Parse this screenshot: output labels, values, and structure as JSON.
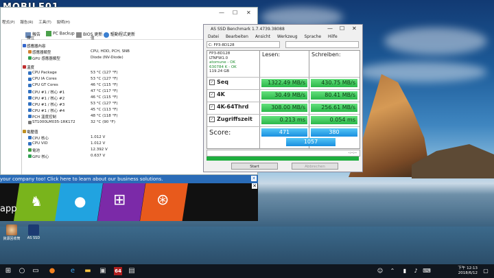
{
  "watermark": "MOBILE01",
  "hwinfo": {
    "menu": [
      "程式(P)",
      "報告(R)",
      "工具(T)",
      "說明(H)"
    ],
    "toolbar": [
      {
        "label": "報告",
        "icon": "report-icon"
      },
      {
        "label": "PC Backup",
        "icon": "backup-icon"
      },
      {
        "label": "BIOS 更新",
        "icon": "bios-icon"
      },
      {
        "label": "驅動程式更新",
        "icon": "driver-update-icon"
      }
    ],
    "columns": {
      "name": "欄位",
      "value": "值"
    },
    "rows": [
      {
        "type": "section",
        "label": "感應器內容",
        "value": "",
        "color": "#3366cc"
      },
      {
        "type": "item",
        "label": "感應器類型",
        "value": "CPU, HDD, PCH, SNB",
        "color": "#d08030"
      },
      {
        "type": "item",
        "label": "GPU 感應器類型",
        "value": "Diode  (NV-Diode)",
        "color": "#30a050"
      },
      {
        "type": "section",
        "label": "溫度",
        "value": "",
        "color": "#c03030"
      },
      {
        "type": "item",
        "label": "CPU Package",
        "value": "53 °C  (127 °F)",
        "color": "#3070c0"
      },
      {
        "type": "item",
        "label": "CPU IA Cores",
        "value": "53 °C  (127 °F)",
        "color": "#3070c0"
      },
      {
        "type": "item",
        "label": "CPU GT Cores",
        "value": "46 °C  (115 °F)",
        "color": "#3070c0"
      },
      {
        "type": "item",
        "label": "CPU #1 / 核心 #1",
        "value": "47 °C  (117 °F)",
        "color": "#3070c0"
      },
      {
        "type": "item",
        "label": "CPU #1 / 核心 #2",
        "value": "46 °C  (115 °F)",
        "color": "#3070c0"
      },
      {
        "type": "item",
        "label": "CPU #1 / 核心 #3",
        "value": "53 °C  (127 °F)",
        "color": "#3070c0"
      },
      {
        "type": "item",
        "label": "CPU #1 / 核心 #4",
        "value": "45 °C  (113 °F)",
        "color": "#3070c0"
      },
      {
        "type": "item",
        "label": "PCH 溫度控制",
        "value": "48 °C  (118 °F)",
        "color": "#3070c0"
      },
      {
        "type": "item",
        "label": "ST1000LM035-1RK172",
        "value": "32 °C  (90 °F)",
        "color": "#777777"
      },
      {
        "type": "section",
        "label": "電壓值",
        "value": "",
        "color": "#c09020"
      },
      {
        "type": "item",
        "label": "CPU 核心",
        "value": "1.012 V",
        "color": "#3070c0"
      },
      {
        "type": "item",
        "label": "CPU VID",
        "value": "1.012 V",
        "color": "#3070c0"
      },
      {
        "type": "item",
        "label": "電池",
        "value": "12.392 V",
        "color": "#40a040"
      },
      {
        "type": "item",
        "label": "GPU 核心",
        "value": "0.637 V",
        "color": "#30a050"
      }
    ]
  },
  "banner": {
    "text": "your company too! Click here to learn about our business solutions.",
    "app_text": "app"
  },
  "assd": {
    "title": "AS SSD Benchmark 1.7.4739.38088",
    "menu": [
      "Datei",
      "Bearbeiten",
      "Ansicht",
      "Werkzeug",
      "Sprache",
      "Hilfe"
    ],
    "drive": "C: FP3-8D128",
    "info": [
      "FP3-8D128",
      "LTNFW1.0",
      "atomune - OK",
      "630784 K - OK",
      "119.24 GB"
    ],
    "read_header": "Lesen:",
    "write_header": "Schreiben:",
    "tests": [
      {
        "name": "Seq",
        "read": "1322.49 MB/s",
        "write": "430.75 MB/s"
      },
      {
        "name": "4K",
        "read": "30.49 MB/s",
        "write": "80.41 MB/s"
      },
      {
        "name": "4K-64Thrd",
        "read": "308.00 MB/s",
        "write": "256.61 MB/s"
      },
      {
        "name": "Zugriffszeit",
        "read": "0.213 ms",
        "write": "0.054 ms"
      }
    ],
    "score_label": "Score:",
    "score_read": "471",
    "score_write": "380",
    "score_total": "1057",
    "progress_text": "-:--:--",
    "start_button": "Start",
    "abort_button": "Abbrechen",
    "colors": {
      "result": "#2bb84a",
      "score": "#1a8fe0"
    }
  },
  "desktop_icons": [
    {
      "label": "資源回收筒",
      "icon": "recycle-bin-icon"
    },
    {
      "label": "AS SSD",
      "icon": "as-ssd-icon"
    }
  ],
  "taskbar": {
    "time": "下午 12:13",
    "date": "2018/6/12",
    "pinned": [
      "windows-start-icon",
      "search-icon",
      "task-view-icon",
      "firefox-icon",
      "chrome-icon",
      "edge-icon",
      "file-explorer-icon",
      "store-icon",
      "hwinfo-icon",
      "as-ssd-taskbar-icon"
    ],
    "pinned_label": "64"
  }
}
